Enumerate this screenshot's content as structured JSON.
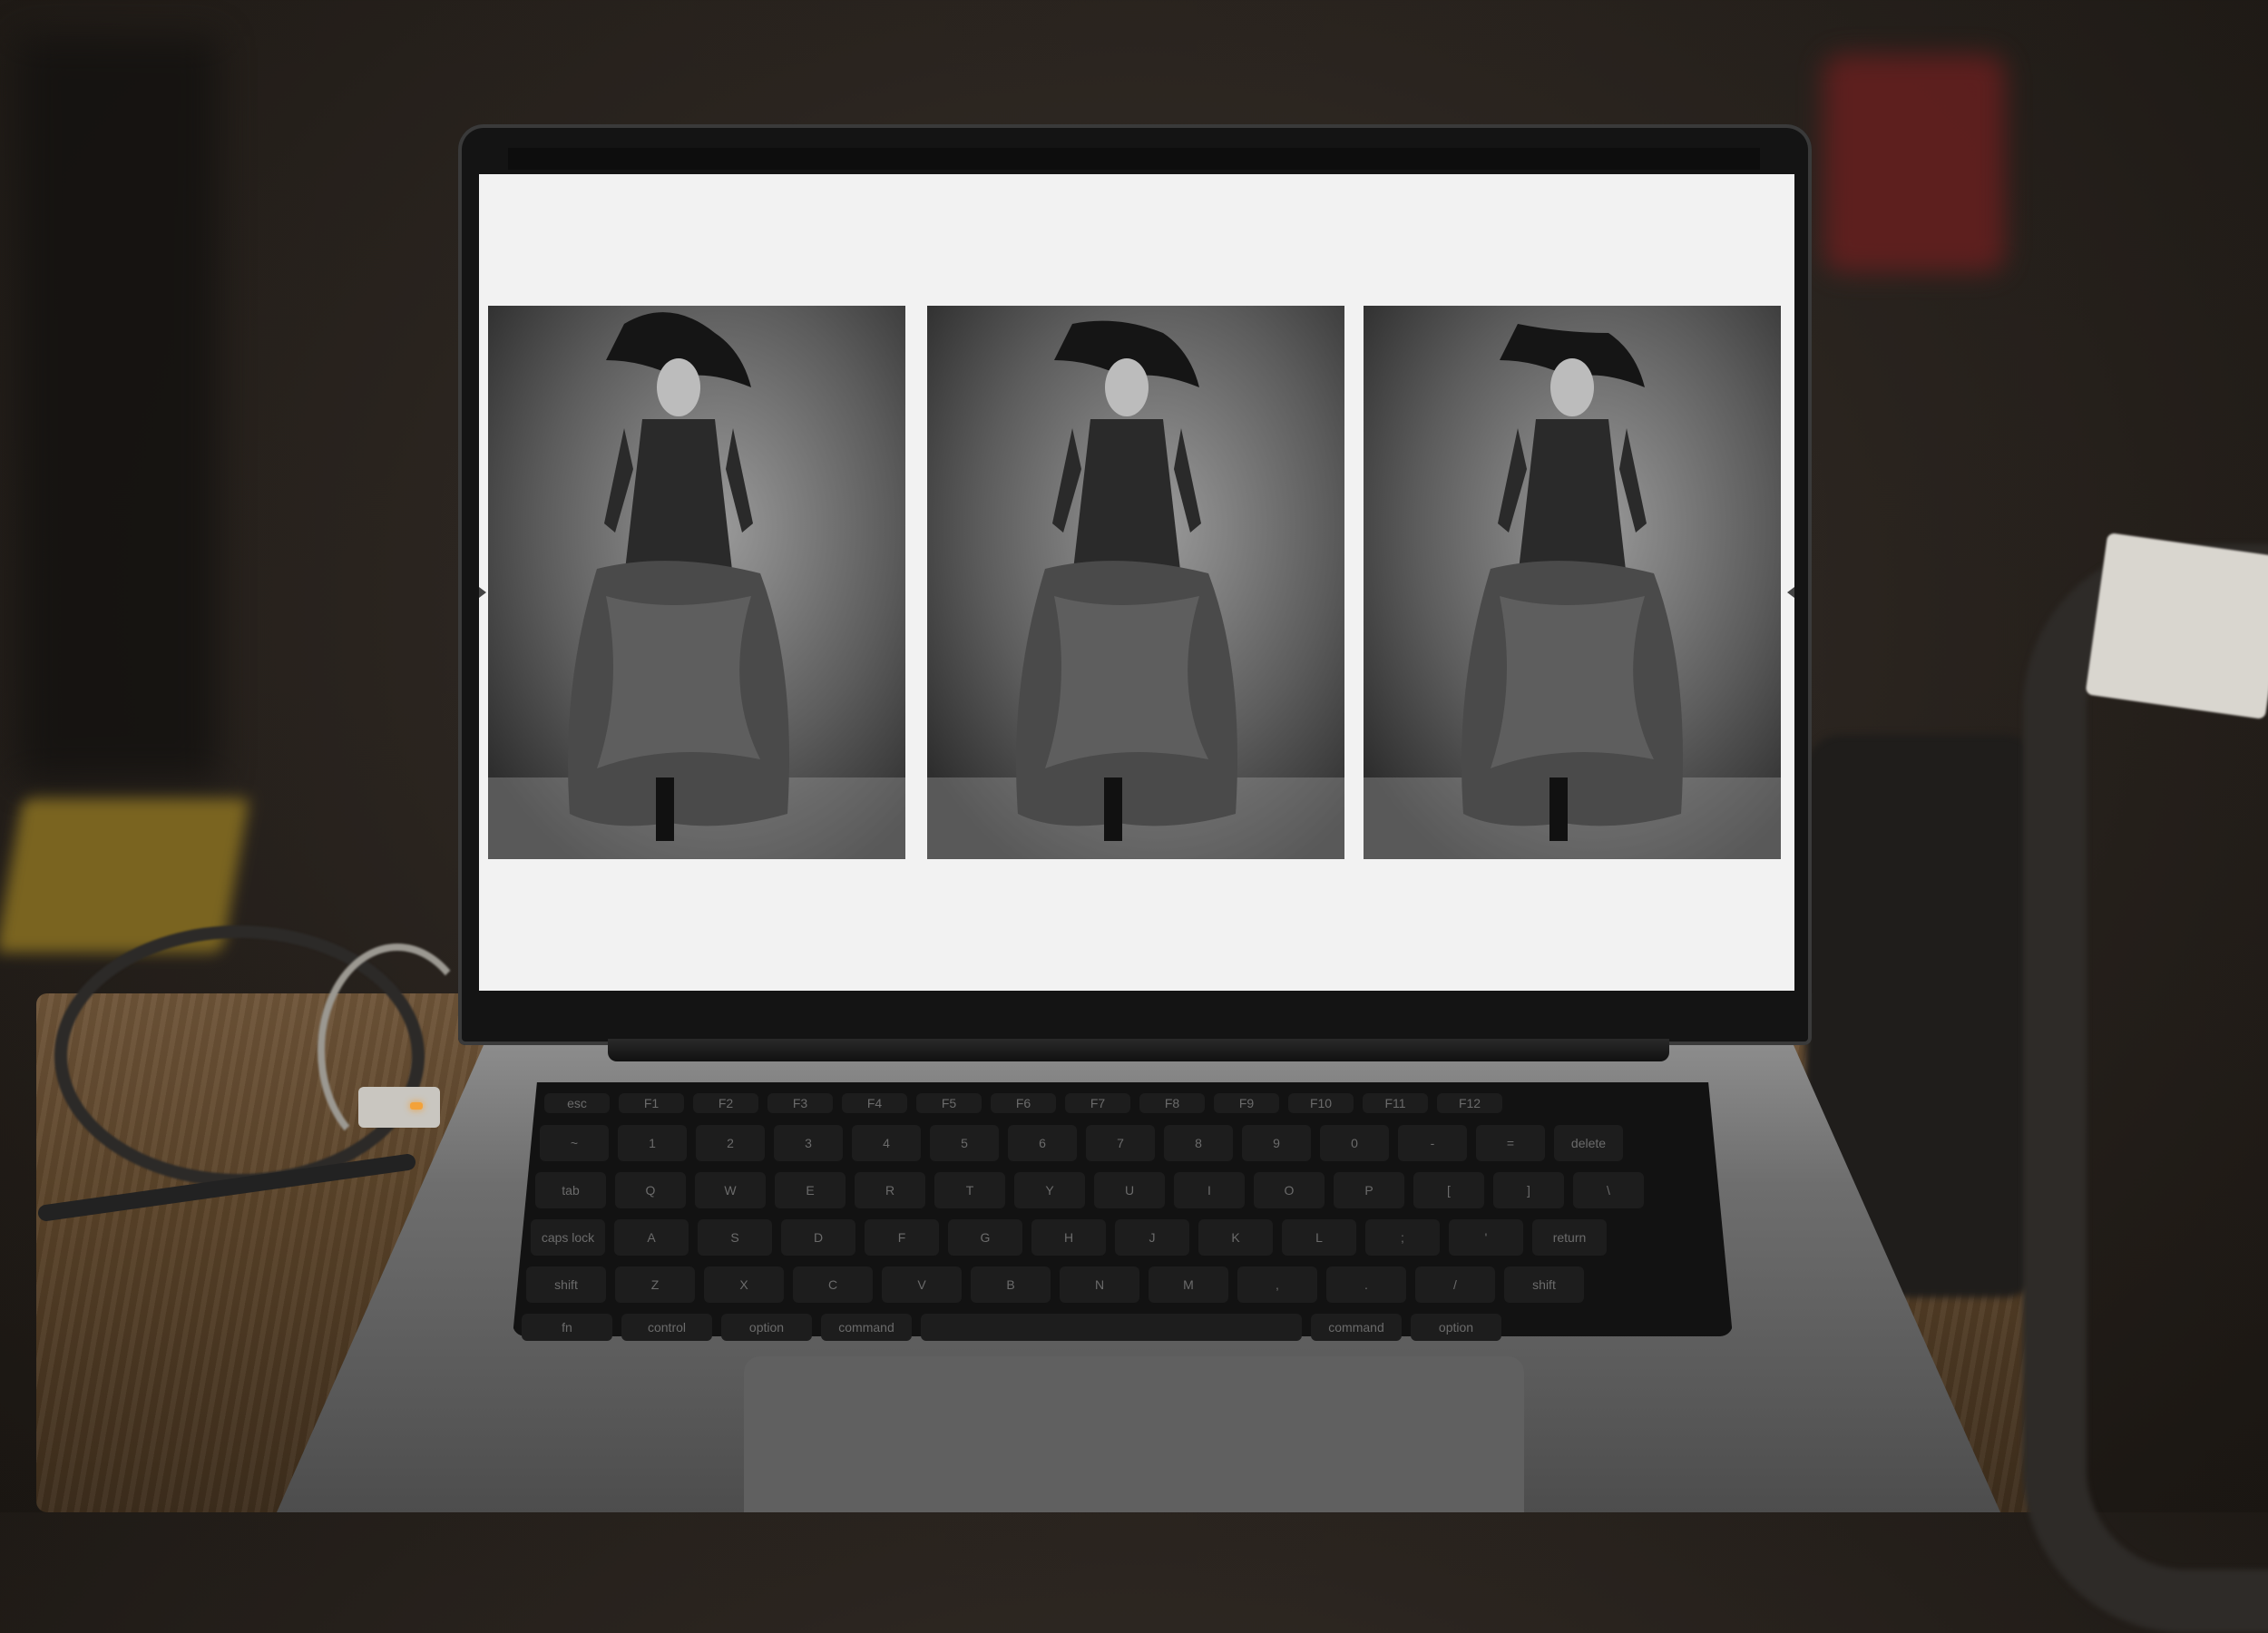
{
  "screen": {
    "background_color": "#f2f2f2",
    "photos": [
      {
        "icon": "fashion-photo",
        "description_alt": "model with flying hair, blazer and ruffled skirt"
      },
      {
        "icon": "fashion-photo",
        "description_alt": "model with flying hair, blazer and ruffled skirt"
      },
      {
        "icon": "fashion-photo",
        "description_alt": "model with flying hair, blazer and ruffled skirt"
      }
    ]
  },
  "keyboard": {
    "fn_row": [
      "esc",
      "F1",
      "F2",
      "F3",
      "F4",
      "F5",
      "F6",
      "F7",
      "F8",
      "F9",
      "F10",
      "F11",
      "F12"
    ],
    "number_row": [
      "~",
      "1",
      "2",
      "3",
      "4",
      "5",
      "6",
      "7",
      "8",
      "9",
      "0",
      "-",
      "=",
      "delete"
    ],
    "qwerty_row": [
      "tab",
      "Q",
      "W",
      "E",
      "R",
      "T",
      "Y",
      "U",
      "I",
      "O",
      "P",
      "[",
      "]",
      "\\"
    ],
    "home_row": [
      "caps lock",
      "A",
      "S",
      "D",
      "F",
      "G",
      "H",
      "J",
      "K",
      "L",
      ";",
      "'",
      "return"
    ],
    "shift_row": [
      "shift",
      "Z",
      "X",
      "C",
      "V",
      "B",
      "N",
      "M",
      ",",
      ".",
      "/",
      "shift"
    ],
    "bottom_row": [
      "fn",
      "control",
      "option",
      "command",
      "",
      "command",
      "option"
    ]
  },
  "colors": {
    "plug_led": "#f3a23a",
    "background_object": "#6b1f1f"
  }
}
